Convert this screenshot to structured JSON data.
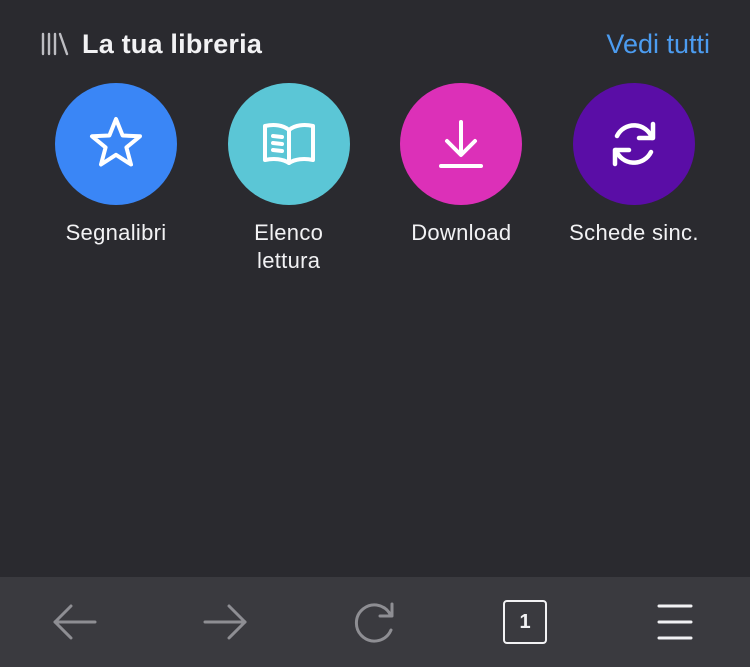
{
  "library": {
    "title": "La tua libreria",
    "see_all": "Vedi tutti",
    "icon": "library-icon",
    "shortcuts": [
      {
        "label": "Segnalibri",
        "icon": "star-icon",
        "color": "#3a86f6"
      },
      {
        "label": "Elenco\nlettura",
        "icon": "book-icon",
        "color": "#5bc6d6"
      },
      {
        "label": "Download",
        "icon": "download-icon",
        "color": "#dc30b8"
      },
      {
        "label": "Schede sinc.",
        "icon": "sync-icon",
        "color": "#5a0da6"
      }
    ]
  },
  "toolbar": {
    "back_icon": "arrow-left-icon",
    "forward_icon": "arrow-right-icon",
    "reload_icon": "reload-icon",
    "tab_count": "1",
    "menu_icon": "hamburger-menu-icon",
    "background": "#3a3a3f",
    "disabled_color": "#8e8e93"
  },
  "colors": {
    "background": "#2a2a2f",
    "accent": "#4c9cf0"
  }
}
